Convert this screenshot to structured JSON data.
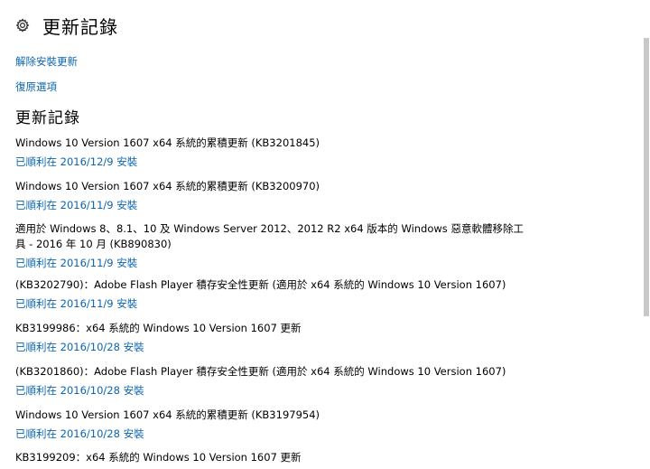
{
  "header": {
    "icon": "gear-icon",
    "title": "更新記錄"
  },
  "links": {
    "uninstall": "解除安裝更新",
    "recovery": "復原選項"
  },
  "section": {
    "title": "更新記錄"
  },
  "updates": [
    {
      "title": "Windows 10 Version 1607 x64 系統的累積更新 (KB3201845)",
      "status": "已順利在 2016/12/9 安裝"
    },
    {
      "title": "Windows 10 Version 1607 x64 系統的累積更新 (KB3200970)",
      "status": "已順利在 2016/11/9 安裝"
    },
    {
      "title": "適用於 Windows 8、8.1、10 及 Windows Server 2012、2012 R2 x64 版本的 Windows 惡意軟體移除工具 - 2016 年 10 月 (KB890830)",
      "status": "已順利在 2016/11/9 安裝"
    },
    {
      "title": "(KB3202790)：Adobe Flash Player 積存安全性更新 (適用於 x64 系統的 Windows 10 Version 1607)",
      "status": "已順利在 2016/11/9 安裝"
    },
    {
      "title": "KB3199986：x64 系統的 Windows 10 Version 1607 更新",
      "status": "已順利在 2016/10/28 安裝"
    },
    {
      "title": "(KB3201860)：Adobe Flash Player 積存安全性更新 (適用於 x64 系統的 Windows 10 Version 1607)",
      "status": "已順利在 2016/10/28 安裝"
    },
    {
      "title": "Windows 10 Version 1607 x64 系統的累積更新 (KB3197954)",
      "status": "已順利在 2016/10/28 安裝"
    },
    {
      "title": "KB3199209：x64 系統的 Windows 10 Version 1607 更新",
      "status": ""
    }
  ],
  "colors": {
    "link": "#0a64b0",
    "text": "#000000",
    "background": "#ffffff"
  }
}
